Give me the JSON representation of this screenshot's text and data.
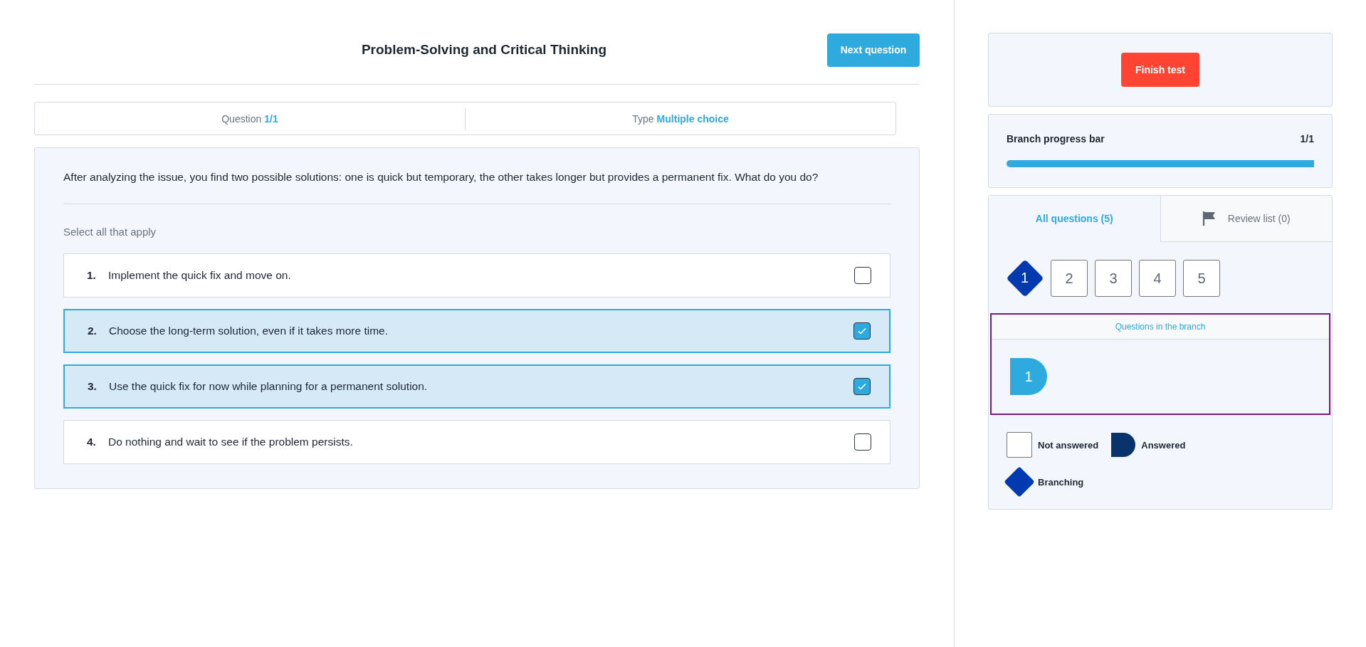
{
  "header": {
    "title": "Problem-Solving and Critical Thinking",
    "next_button": "Next question"
  },
  "info": {
    "question_label": "Question",
    "question_value": "1/1",
    "type_label": "Type",
    "type_value": "Multiple choice"
  },
  "question": {
    "text": "After analyzing the issue, you find two possible solutions: one is quick but temporary, the other takes longer but provides a permanent fix. What do you do?",
    "instruction": "Select all that apply",
    "options": [
      {
        "number": "1.",
        "text": "Implement the quick fix and move on.",
        "checked": false
      },
      {
        "number": "2.",
        "text": "Choose the long-term solution, even if it takes more time.",
        "checked": true
      },
      {
        "number": "3.",
        "text": "Use the quick fix for now while planning for a permanent solution.",
        "checked": true
      },
      {
        "number": "4.",
        "text": "Do nothing and wait to see if the problem persists.",
        "checked": false
      }
    ]
  },
  "sidebar": {
    "finish_button": "Finish test",
    "progress": {
      "label": "Branch progress bar",
      "count": "1/1",
      "level": 1
    },
    "tabs": [
      {
        "label": "All questions (5)",
        "selected": true,
        "kind": "plain"
      },
      {
        "label": "Review list (0)",
        "selected": false,
        "kind": "flag"
      }
    ],
    "questions": [
      {
        "label": "1",
        "kind": "branching"
      },
      {
        "label": "2",
        "kind": "not_answered"
      },
      {
        "label": "3",
        "kind": "not_answered"
      },
      {
        "label": "4",
        "kind": "not_answered"
      },
      {
        "label": "5",
        "kind": "not_answered"
      }
    ],
    "branch": {
      "title": "Questions in the branch",
      "questions": [
        {
          "label": "1",
          "kind": "answered"
        }
      ]
    },
    "legend": [
      {
        "label": "Not answered",
        "kind": "not_answered"
      },
      {
        "label": "Answered",
        "kind": "answered"
      },
      {
        "label": "Branching",
        "kind": "branching"
      }
    ]
  }
}
